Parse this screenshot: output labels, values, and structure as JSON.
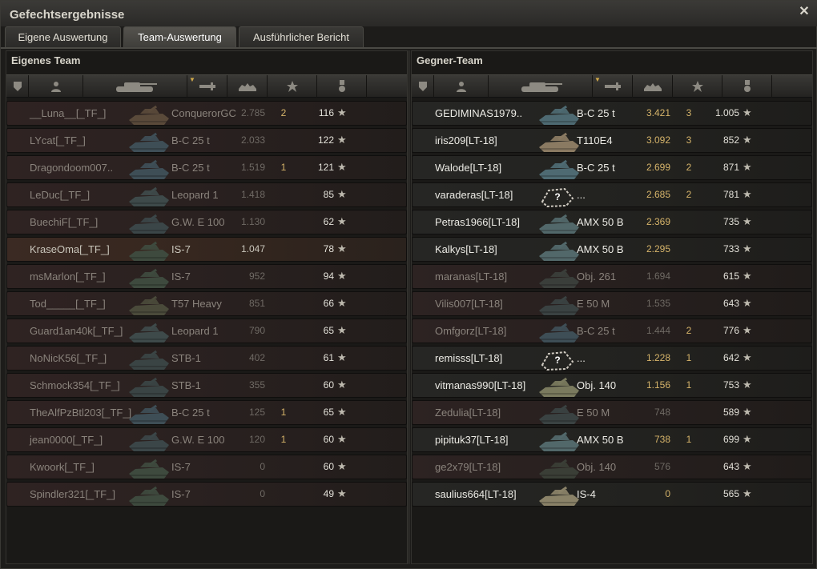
{
  "window": {
    "title": "Gefechtsergebnisse",
    "close_glyph": "✕"
  },
  "tabs": [
    {
      "label": "Eigene Auswertung",
      "active": false
    },
    {
      "label": "Team-Auswertung",
      "active": true
    },
    {
      "label": "Ausführlicher Bericht",
      "active": false
    }
  ],
  "columns": [
    "squad-icon",
    "player-icon",
    "tank-icon",
    "damage-icon",
    "kills-icon",
    "xp-star-icon",
    "medal-icon"
  ],
  "star_glyph": "★",
  "own_team": {
    "title": "Eigenes Team",
    "rows": [
      {
        "name": "__Luna__[_TF_]",
        "tank": "ConquerorGC",
        "dmg": "2.785",
        "kills": "2",
        "xp": "116",
        "state": "dead",
        "tank_color": "#5a4a3a"
      },
      {
        "name": "LYcat[_TF_]",
        "tank": "B-C 25 t",
        "dmg": "2.033",
        "kills": "",
        "xp": "122",
        "state": "dead",
        "tank_color": "#3e4e56"
      },
      {
        "name": "Dragondoom007..",
        "tank": "B-C 25 t",
        "dmg": "1.519",
        "kills": "1",
        "xp": "121",
        "state": "dead",
        "tank_color": "#3e4e56"
      },
      {
        "name": "LeDuc[_TF_]",
        "tank": "Leopard 1",
        "dmg": "1.418",
        "kills": "",
        "xp": "85",
        "state": "dead",
        "tank_color": "#3e4a4a"
      },
      {
        "name": "BuechiF[_TF_]",
        "tank": "G.W. E 100",
        "dmg": "1.130",
        "kills": "",
        "xp": "62",
        "state": "dead",
        "tank_color": "#3b4648"
      },
      {
        "name": "KraseOma[_TF_]",
        "tank": "IS-7",
        "dmg": "1.047",
        "kills": "",
        "xp": "78",
        "state": "self",
        "tank_color": "#3e4a3e"
      },
      {
        "name": "msMarlon[_TF_]",
        "tank": "IS-7",
        "dmg": "952",
        "kills": "",
        "xp": "94",
        "state": "dead",
        "tank_color": "#3e4a3e"
      },
      {
        "name": "Tod_____[_TF_]",
        "tank": "T57 Heavy",
        "dmg": "851",
        "kills": "",
        "xp": "66",
        "state": "dead",
        "tank_color": "#4a4a3a"
      },
      {
        "name": "Guard1an40k[_TF_]",
        "tank": "Leopard 1",
        "dmg": "790",
        "kills": "",
        "xp": "65",
        "state": "dead",
        "tank_color": "#3e4a4a"
      },
      {
        "name": "NoNicK56[_TF_]",
        "tank": "STB-1",
        "dmg": "402",
        "kills": "",
        "xp": "61",
        "state": "dead",
        "tank_color": "#3a4444"
      },
      {
        "name": "Schmock354[_TF_]",
        "tank": "STB-1",
        "dmg": "355",
        "kills": "",
        "xp": "60",
        "state": "dead",
        "tank_color": "#3a4444"
      },
      {
        "name": "TheAlfPzBtl203[_TF_]",
        "tank": "B-C 25 t",
        "dmg": "125",
        "kills": "1",
        "xp": "65",
        "state": "dead",
        "tank_color": "#3e4e56"
      },
      {
        "name": "jean0000[_TF_]",
        "tank": "G.W. E 100",
        "dmg": "120",
        "kills": "1",
        "xp": "60",
        "state": "dead",
        "tank_color": "#3b4648"
      },
      {
        "name": "Kwoork[_TF_]",
        "tank": "IS-7",
        "dmg": "0",
        "kills": "",
        "xp": "60",
        "state": "dead",
        "tank_color": "#3e4a3e"
      },
      {
        "name": "Spindler321[_TF_]",
        "tank": "IS-7",
        "dmg": "0",
        "kills": "",
        "xp": "49",
        "state": "dead",
        "tank_color": "#3e4a3e"
      }
    ]
  },
  "enemy_team": {
    "title": "Gegner-Team",
    "rows": [
      {
        "name": "GEDIMINAS1979..",
        "tank": "B-C 25 t",
        "dmg": "3.421",
        "kills": "3",
        "xp": "1.005",
        "state": "alive",
        "tank_color": "#4e6a72"
      },
      {
        "name": "iris209[LT-18]",
        "tank": "T110E4",
        "dmg": "3.092",
        "kills": "3",
        "xp": "852",
        "state": "alive",
        "tank_color": "#8a7a62"
      },
      {
        "name": "Walode[LT-18]",
        "tank": "B-C 25 t",
        "dmg": "2.699",
        "kills": "2",
        "xp": "871",
        "state": "alive",
        "tank_color": "#4e6a72"
      },
      {
        "name": "varaderas[LT-18]",
        "tank": "...",
        "dmg": "2.685",
        "kills": "2",
        "xp": "781",
        "state": "alive",
        "tank_color": "unknown"
      },
      {
        "name": "Petras1966[LT-18]",
        "tank": "AMX 50 B",
        "dmg": "2.369",
        "kills": "",
        "xp": "735",
        "state": "alive",
        "tank_color": "#52686a"
      },
      {
        "name": "Kalkys[LT-18]",
        "tank": "AMX 50 B",
        "dmg": "2.295",
        "kills": "",
        "xp": "733",
        "state": "alive",
        "tank_color": "#52686a"
      },
      {
        "name": "maranas[LT-18]",
        "tank": "Obj. 261",
        "dmg": "1.694",
        "kills": "",
        "xp": "615",
        "state": "dead",
        "tank_color": "#3a3e3a"
      },
      {
        "name": "Vilis007[LT-18]",
        "tank": "E 50 M",
        "dmg": "1.535",
        "kills": "",
        "xp": "643",
        "state": "dead",
        "tank_color": "#3a4242"
      },
      {
        "name": "Omfgorz[LT-18]",
        "tank": "B-C 25 t",
        "dmg": "1.444",
        "kills": "2",
        "xp": "776",
        "state": "dead",
        "tank_color": "#3e4e56"
      },
      {
        "name": "remisss[LT-18]",
        "tank": "...",
        "dmg": "1.228",
        "kills": "1",
        "xp": "642",
        "state": "alive",
        "tank_color": "unknown"
      },
      {
        "name": "vitmanas990[LT-18]",
        "tank": "Obj. 140",
        "dmg": "1.156",
        "kills": "1",
        "xp": "753",
        "state": "alive",
        "tank_color": "#7a7a5e"
      },
      {
        "name": "Zedulia[LT-18]",
        "tank": "E 50 M",
        "dmg": "748",
        "kills": "",
        "xp": "589",
        "state": "dead",
        "tank_color": "#3a4242"
      },
      {
        "name": "pipituk37[LT-18]",
        "tank": "AMX 50 B",
        "dmg": "738",
        "kills": "1",
        "xp": "699",
        "state": "alive",
        "tank_color": "#52686a"
      },
      {
        "name": "ge2x79[LT-18]",
        "tank": "Obj. 140",
        "dmg": "576",
        "kills": "",
        "xp": "643",
        "state": "dead",
        "tank_color": "#3a3e36"
      },
      {
        "name": "saulius664[LT-18]",
        "tank": "IS-4",
        "dmg": "0",
        "kills": "",
        "xp": "565",
        "state": "alive",
        "tank_color": "#8a8268"
      }
    ]
  }
}
